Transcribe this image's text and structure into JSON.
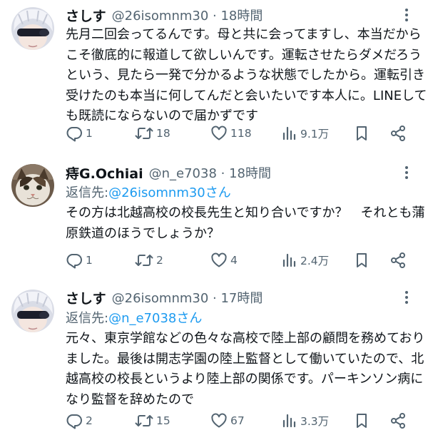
{
  "tweets": [
    {
      "name": "さしす",
      "meta": "@26isomnm30 · 18時間",
      "reply_to": null,
      "lines": [
        "先月二回会ってるんです。母と共に会ってますし、本当だから",
        "こそ徹底的に報道して欲しいんです。運転させたらダメだろう",
        "という、見たら一発で分かるような状態でしたから。運転引き",
        "受けたのも本当に何してんだと会いたいです本人に。LINEして",
        "も既読にならないので届かずです"
      ],
      "replies": "1",
      "retweets": "18",
      "likes": "118",
      "views": "9.1万"
    },
    {
      "name": "痔G.Ochiai",
      "meta": "@n_e7038 · 18時間",
      "reply_to": {
        "prefix": "返信先: ",
        "mention": "@26isomnm30さん"
      },
      "lines": [
        "その方は北越高校の校長先生と知り合いですか？　それとも蒲",
        "原鉄道のほうでしょうか？"
      ],
      "replies": "1",
      "retweets": "2",
      "likes": "4",
      "views": "2.4万"
    },
    {
      "name": "さしす",
      "meta": "@26isomnm30 · 17時間",
      "reply_to": {
        "prefix": "返信先: ",
        "mention": "@n_e7038さん"
      },
      "lines": [
        "元々、東京学館などの色々な高校で陸上部の顧問を務めており",
        "ました。最後は開志学園の陸上監督として働いていたので、北",
        "越高校の校長というより陸上部の関係です。パーキンソン病に",
        "なり監督を辞めたので"
      ],
      "replies": "2",
      "retweets": "15",
      "likes": "67",
      "views": "3.3万"
    }
  ],
  "colors": {
    "text": "#0f1419",
    "secondary": "#536471",
    "link": "#1d9bf0"
  },
  "icons": [
    "reply-icon",
    "retweet-icon",
    "like-icon",
    "views-icon",
    "bookmark-icon",
    "share-icon",
    "more-icon"
  ]
}
